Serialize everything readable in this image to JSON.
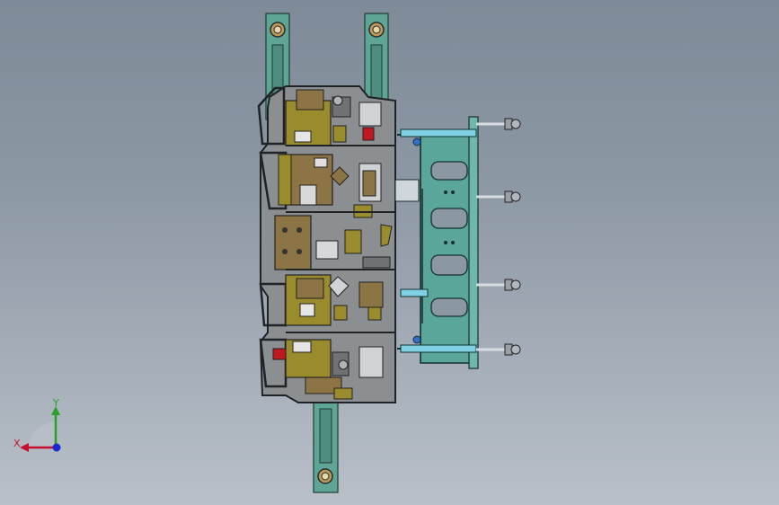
{
  "viewport": {
    "background_top": "#7f8a98",
    "background_bottom": "#b9c0c8"
  },
  "model": {
    "colors": {
      "rail": "#5fa596",
      "frame": "#3a3f44",
      "plate": "#8c8f92",
      "olive": "#9a8c2c",
      "brown": "#8d7444",
      "red": "#c0181e",
      "bracket": "#5aa69a",
      "bolt": "#9aa0a6",
      "cyan_part": "#7fd0e4"
    }
  },
  "triad": {
    "x_label": "X",
    "y_label": "Y",
    "x_color": "#c8102e",
    "y_color": "#2aa02a",
    "z_color": "#1a2ad0"
  }
}
